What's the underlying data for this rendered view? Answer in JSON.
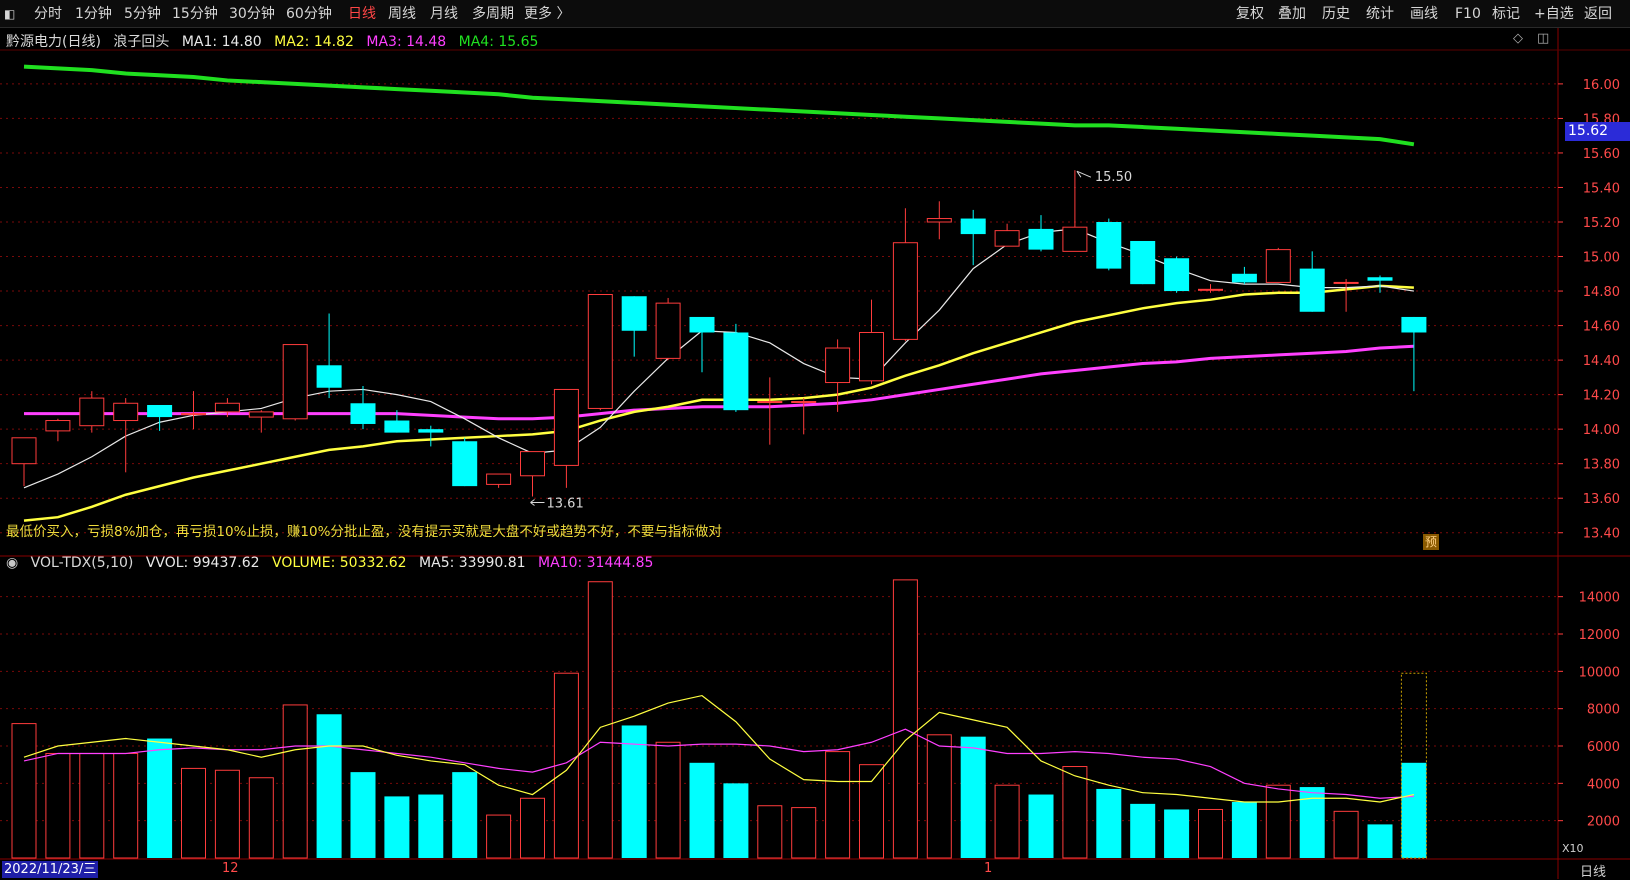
{
  "toolbar": {
    "left_items": [
      "分时",
      "1分钟",
      "5分钟",
      "15分钟",
      "30分钟",
      "60分钟",
      "日线",
      "周线",
      "月线",
      "多周期",
      "更多 〉"
    ],
    "active": "日线",
    "right_items": [
      "复权",
      "叠加",
      "历史",
      "统计",
      "画线",
      "F10",
      "标记",
      "+自选",
      "返回"
    ]
  },
  "header": {
    "stock_name": "黔源电力(日线)",
    "indicator": "浪子回头",
    "ma1_label": "MA1: 14.80",
    "ma2_label": "MA2: 14.82",
    "ma3_label": "MA3: 14.48",
    "ma4_label": "MA4: 15.65"
  },
  "colors": {
    "up": "#ff3c3c",
    "down": "#00ffff",
    "ma1": "#e8e8e8",
    "ma2": "#ffff40",
    "ma3": "#ff40ff",
    "ma4": "#20e020",
    "grid": "#7a0a0a"
  },
  "strategy_text": "最低价买入，亏损8%加仓，再亏损10%止损，赚10%分批止盈，没有提示买就是大盘不好或趋势不好，不要与指标做对",
  "current_price_tag": "15.62",
  "preview_badge": "预",
  "high_mark": "15.50",
  "low_mark": "13.61",
  "volume_header": {
    "name": "VOL-TDX(5,10)",
    "vvol": "VVOL: 99437.62",
    "volume": "VOLUME: 50332.62",
    "ma5": "MA5: 33990.81",
    "ma10": "MA10: 31444.85"
  },
  "x_axis": {
    "date_tag": "2022/11/23/三",
    "month_labels": [
      "12",
      "1"
    ],
    "period": "日线",
    "vol_unit": "X10"
  },
  "chart_data": {
    "type": "candlestick",
    "price_axis": [
      "16.00",
      "15.80",
      "15.60",
      "15.40",
      "15.20",
      "15.00",
      "14.80",
      "14.60",
      "14.40",
      "14.20",
      "14.00",
      "13.80",
      "13.60",
      "13.40"
    ],
    "volume_axis": [
      "14000",
      "12000",
      "10000",
      "8000",
      "6000",
      "4000",
      "2000"
    ],
    "ylim_price": [
      13.3,
      16.15
    ],
    "ylim_volume": [
      0,
      15000
    ],
    "candles": [
      {
        "o": 13.8,
        "h": 13.85,
        "l": 13.67,
        "c": 13.95
      },
      {
        "o": 13.99,
        "h": 14.06,
        "l": 13.93,
        "c": 14.05
      },
      {
        "o": 14.02,
        "h": 14.22,
        "l": 13.98,
        "c": 14.18
      },
      {
        "o": 14.05,
        "h": 14.18,
        "l": 13.75,
        "c": 14.15
      },
      {
        "o": 14.14,
        "h": 14.14,
        "l": 13.99,
        "c": 14.07
      },
      {
        "o": 14.09,
        "h": 14.22,
        "l": 14.0,
        "c": 14.09
      },
      {
        "o": 14.1,
        "h": 14.18,
        "l": 14.07,
        "c": 14.15
      },
      {
        "o": 14.07,
        "h": 14.11,
        "l": 13.98,
        "c": 14.1
      },
      {
        "o": 14.06,
        "h": 14.4,
        "l": 14.05,
        "c": 14.49
      },
      {
        "o": 14.37,
        "h": 14.67,
        "l": 14.18,
        "c": 14.24
      },
      {
        "o": 14.15,
        "h": 14.25,
        "l": 14.0,
        "c": 14.03
      },
      {
        "o": 14.05,
        "h": 14.11,
        "l": 13.98,
        "c": 13.98
      },
      {
        "o": 14.0,
        "h": 14.02,
        "l": 13.9,
        "c": 13.98
      },
      {
        "o": 13.93,
        "h": 13.95,
        "l": 13.67,
        "c": 13.67
      },
      {
        "o": 13.68,
        "h": 13.74,
        "l": 13.66,
        "c": 13.74
      },
      {
        "o": 13.73,
        "h": 13.87,
        "l": 13.61,
        "c": 13.87
      },
      {
        "o": 13.79,
        "h": 14.23,
        "l": 13.66,
        "c": 14.23
      },
      {
        "o": 14.12,
        "h": 14.78,
        "l": 14.11,
        "c": 14.78
      },
      {
        "o": 14.77,
        "h": 14.77,
        "l": 14.42,
        "c": 14.57
      },
      {
        "o": 14.41,
        "h": 14.76,
        "l": 14.4,
        "c": 14.73
      },
      {
        "o": 14.65,
        "h": 14.65,
        "l": 14.33,
        "c": 14.56
      },
      {
        "o": 14.56,
        "h": 14.61,
        "l": 14.1,
        "c": 14.11
      },
      {
        "o": 14.16,
        "h": 14.3,
        "l": 13.91,
        "c": 14.16
      },
      {
        "o": 14.16,
        "h": 14.18,
        "l": 13.97,
        "c": 14.16
      },
      {
        "o": 14.27,
        "h": 14.52,
        "l": 14.1,
        "c": 14.47
      },
      {
        "o": 14.28,
        "h": 14.75,
        "l": 14.26,
        "c": 14.56
      },
      {
        "o": 14.52,
        "h": 15.28,
        "l": 14.51,
        "c": 15.08
      },
      {
        "o": 15.2,
        "h": 15.32,
        "l": 15.1,
        "c": 15.22
      },
      {
        "o": 15.22,
        "h": 15.27,
        "l": 14.95,
        "c": 15.13
      },
      {
        "o": 15.06,
        "h": 15.19,
        "l": 15.06,
        "c": 15.15
      },
      {
        "o": 15.16,
        "h": 15.24,
        "l": 15.03,
        "c": 15.04
      },
      {
        "o": 15.03,
        "h": 15.5,
        "l": 15.03,
        "c": 15.17
      },
      {
        "o": 15.2,
        "h": 15.22,
        "l": 14.92,
        "c": 14.93
      },
      {
        "o": 15.09,
        "h": 15.09,
        "l": 14.84,
        "c": 14.84
      },
      {
        "o": 14.99,
        "h": 15.0,
        "l": 14.79,
        "c": 14.8
      },
      {
        "o": 14.81,
        "h": 14.84,
        "l": 14.79,
        "c": 14.81
      },
      {
        "o": 14.9,
        "h": 14.94,
        "l": 14.84,
        "c": 14.85
      },
      {
        "o": 14.85,
        "h": 15.05,
        "l": 14.85,
        "c": 15.04
      },
      {
        "o": 14.93,
        "h": 15.03,
        "l": 14.68,
        "c": 14.68
      },
      {
        "o": 14.85,
        "h": 14.87,
        "l": 14.68,
        "c": 14.85
      },
      {
        "o": 14.88,
        "h": 14.89,
        "l": 14.79,
        "c": 14.86
      },
      {
        "o": 14.65,
        "h": 14.65,
        "l": 14.22,
        "c": 14.56
      }
    ],
    "ma1": [
      13.66,
      13.74,
      13.84,
      13.96,
      14.04,
      14.08,
      14.1,
      14.12,
      14.18,
      14.22,
      14.23,
      14.2,
      14.16,
      14.06,
      13.95,
      13.86,
      13.88,
      14.01,
      14.22,
      14.41,
      14.57,
      14.56,
      14.5,
      14.38,
      14.3,
      14.29,
      14.5,
      14.69,
      14.93,
      15.07,
      15.14,
      15.16,
      15.08,
      15.01,
      14.93,
      14.86,
      14.84,
      14.84,
      14.82,
      14.82,
      14.83,
      14.8
    ],
    "ma2": [
      13.47,
      13.49,
      13.55,
      13.62,
      13.67,
      13.72,
      13.76,
      13.8,
      13.84,
      13.88,
      13.9,
      13.93,
      13.94,
      13.95,
      13.96,
      13.97,
      13.99,
      14.05,
      14.1,
      14.13,
      14.17,
      14.17,
      14.17,
      14.18,
      14.2,
      14.24,
      14.31,
      14.37,
      14.44,
      14.5,
      14.56,
      14.62,
      14.66,
      14.7,
      14.73,
      14.75,
      14.78,
      14.79,
      14.79,
      14.81,
      14.83,
      14.82
    ],
    "ma3": [
      14.09,
      14.09,
      14.09,
      14.09,
      14.09,
      14.09,
      14.09,
      14.09,
      14.09,
      14.09,
      14.09,
      14.09,
      14.08,
      14.07,
      14.06,
      14.06,
      14.07,
      14.09,
      14.11,
      14.12,
      14.13,
      14.13,
      14.13,
      14.14,
      14.15,
      14.17,
      14.2,
      14.23,
      14.26,
      14.29,
      14.32,
      14.34,
      14.36,
      14.38,
      14.39,
      14.41,
      14.42,
      14.43,
      14.44,
      14.45,
      14.47,
      14.48
    ],
    "ma4": [
      16.1,
      16.09,
      16.08,
      16.06,
      16.05,
      16.04,
      16.02,
      16.01,
      16.0,
      15.99,
      15.98,
      15.97,
      15.96,
      15.95,
      15.94,
      15.92,
      15.91,
      15.9,
      15.89,
      15.88,
      15.87,
      15.86,
      15.85,
      15.84,
      15.83,
      15.82,
      15.81,
      15.8,
      15.79,
      15.78,
      15.77,
      15.76,
      15.76,
      15.75,
      15.74,
      15.73,
      15.72,
      15.71,
      15.7,
      15.69,
      15.68,
      15.65
    ],
    "volume": [
      7200,
      5600,
      5600,
      5600,
      6400,
      4800,
      4700,
      4300,
      8200,
      7700,
      4600,
      3300,
      3400,
      4600,
      2300,
      3200,
      9900,
      14800,
      7100,
      6200,
      5100,
      4000,
      2800,
      2700,
      5700,
      5000,
      14900,
      6600,
      6500,
      3900,
      3400,
      4900,
      3700,
      2900,
      2600,
      2600,
      3000,
      3900,
      3800,
      2500,
      1800,
      5100
    ],
    "preview_volume": 9900,
    "vol_ma5": [
      5400,
      6000,
      6200,
      6400,
      6200,
      6000,
      5800,
      5400,
      5800,
      6000,
      6000,
      5500,
      5200,
      5000,
      3900,
      3400,
      4700,
      7000,
      7600,
      8300,
      8700,
      7300,
      5300,
      4200,
      4100,
      4100,
      6300,
      7800,
      7400,
      7000,
      5200,
      4400,
      3900,
      3500,
      3400,
      3200,
      3000,
      3000,
      3200,
      3200,
      3000,
      3400
    ],
    "vol_ma10": [
      5200,
      5600,
      5600,
      5600,
      5800,
      5900,
      5800,
      5800,
      6000,
      6000,
      5800,
      5600,
      5400,
      5100,
      4800,
      4600,
      5100,
      6200,
      6100,
      6000,
      6100,
      6100,
      6000,
      5700,
      5800,
      6200,
      6900,
      6000,
      5900,
      5600,
      5600,
      5700,
      5600,
      5400,
      5300,
      4900,
      4000,
      3700,
      3500,
      3400,
      3200,
      3300
    ]
  }
}
